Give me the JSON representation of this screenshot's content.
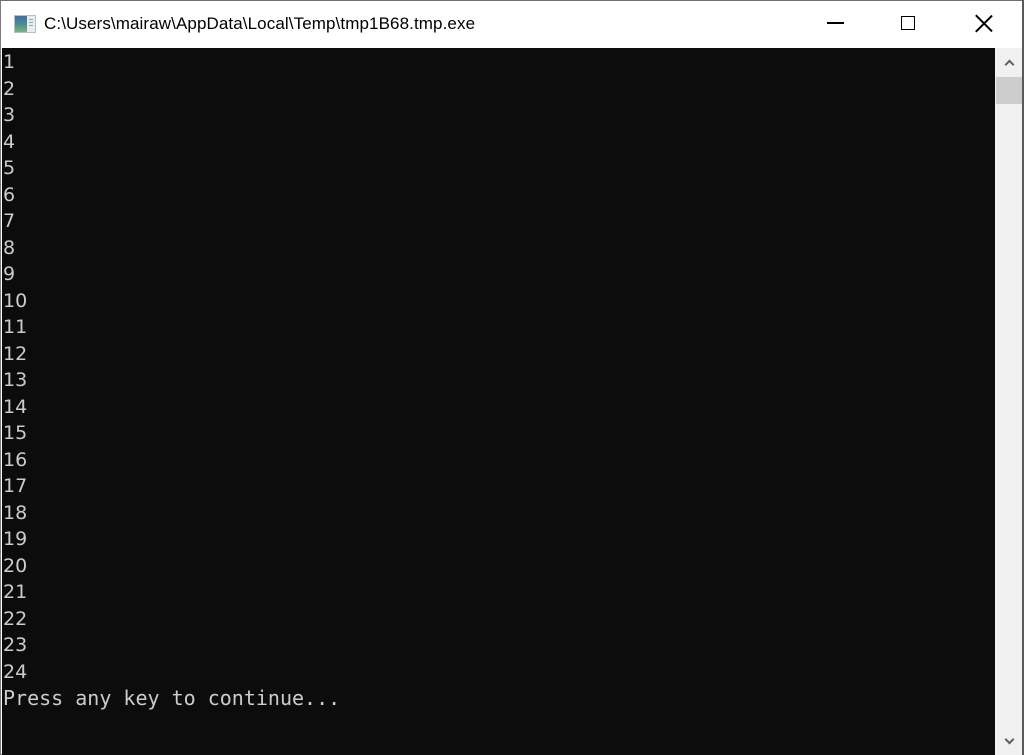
{
  "window": {
    "title": "C:\\Users\\mairaw\\AppData\\Local\\Temp\\tmp1B68.tmp.exe",
    "icon": "console-app-icon",
    "controls": {
      "minimize": "minimize",
      "maximize": "maximize",
      "close": "close"
    }
  },
  "console": {
    "lines": [
      "1",
      "2",
      "3",
      "4",
      "5",
      "6",
      "7",
      "8",
      "9",
      "10",
      "11",
      "12",
      "13",
      "14",
      "15",
      "16",
      "17",
      "18",
      "19",
      "20",
      "21",
      "22",
      "23",
      "24"
    ],
    "prompt": "Press any key to continue...",
    "background": "#0c0c0c",
    "foreground": "#cccccc"
  },
  "scrollbar": {
    "up_icon": "chevron-up-icon",
    "down_icon": "chevron-down-icon"
  }
}
